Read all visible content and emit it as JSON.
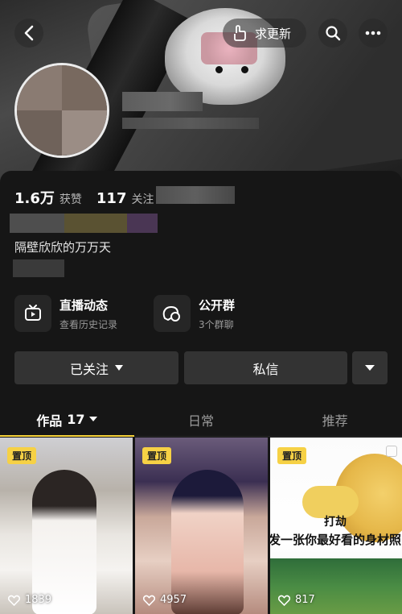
{
  "header": {
    "update_label": "求更新"
  },
  "stats": {
    "likes_count": "1.6万",
    "likes_label": "获赞",
    "following_count": "117",
    "following_label": "关注"
  },
  "bio": "隔壁欣欣的万万天",
  "features": [
    {
      "title": "直播动态",
      "subtitle": "查看历史记录",
      "icon": "tv-icon"
    },
    {
      "title": "公开群",
      "subtitle": "3个群聊",
      "icon": "chat-bubbles-icon"
    }
  ],
  "actions": {
    "follow_label": "已关注",
    "message_label": "私信"
  },
  "tabs": [
    {
      "label": "作品",
      "count": "17",
      "active": true
    },
    {
      "label": "日常",
      "active": false
    },
    {
      "label": "推荐",
      "active": false
    }
  ],
  "videos": [
    {
      "pinned_label": "置顶",
      "likes": "1839"
    },
    {
      "pinned_label": "置顶",
      "likes": "4957"
    },
    {
      "pinned_label": "置顶",
      "likes": "817",
      "overlay_line1": "打劫",
      "overlay_line2": "发一张你最好看的身材照"
    }
  ],
  "colors": {
    "accent": "#f7d23a",
    "background": "#161616",
    "button_bg": "#333333",
    "pin_badge": "#f6d145"
  }
}
